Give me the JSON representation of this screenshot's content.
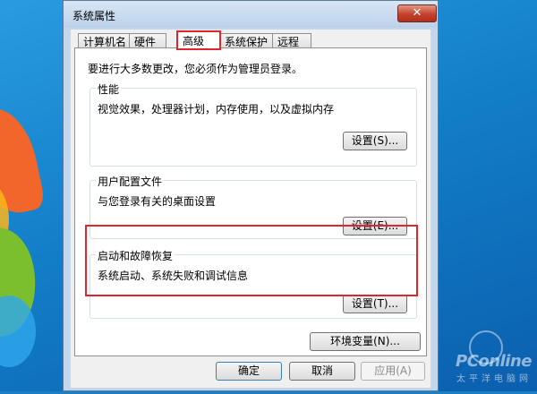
{
  "window": {
    "title": "系统属性",
    "close_label": "✕"
  },
  "tabs": [
    {
      "label": "计算机名"
    },
    {
      "label": "硬件"
    },
    {
      "label": "高级"
    },
    {
      "label": "系统保护"
    },
    {
      "label": "远程"
    }
  ],
  "active_tab": "高级",
  "intro": "要进行大多数更改，您必须作为管理员登录。",
  "performance": {
    "title": "性能",
    "description": "视觉效果，处理器计划，内存使用，以及虚拟内存",
    "button": "设置(S)..."
  },
  "user_profiles": {
    "title": "用户配置文件",
    "description": "与您登录有关的桌面设置",
    "button": "设置(E)..."
  },
  "startup_recovery": {
    "title": "启动和故障恢复",
    "description": "系统启动、系统失败和调试信息",
    "button": "设置(T)..."
  },
  "env_button": "环境变量(N)...",
  "footer": {
    "ok": "确定",
    "cancel": "取消",
    "apply": "应用(A)"
  },
  "watermark": {
    "brand": "PConline",
    "tagline": "太平洋电脑网"
  },
  "colors": {
    "highlight": "#e0262b",
    "desktop": "#1c7fc4"
  }
}
